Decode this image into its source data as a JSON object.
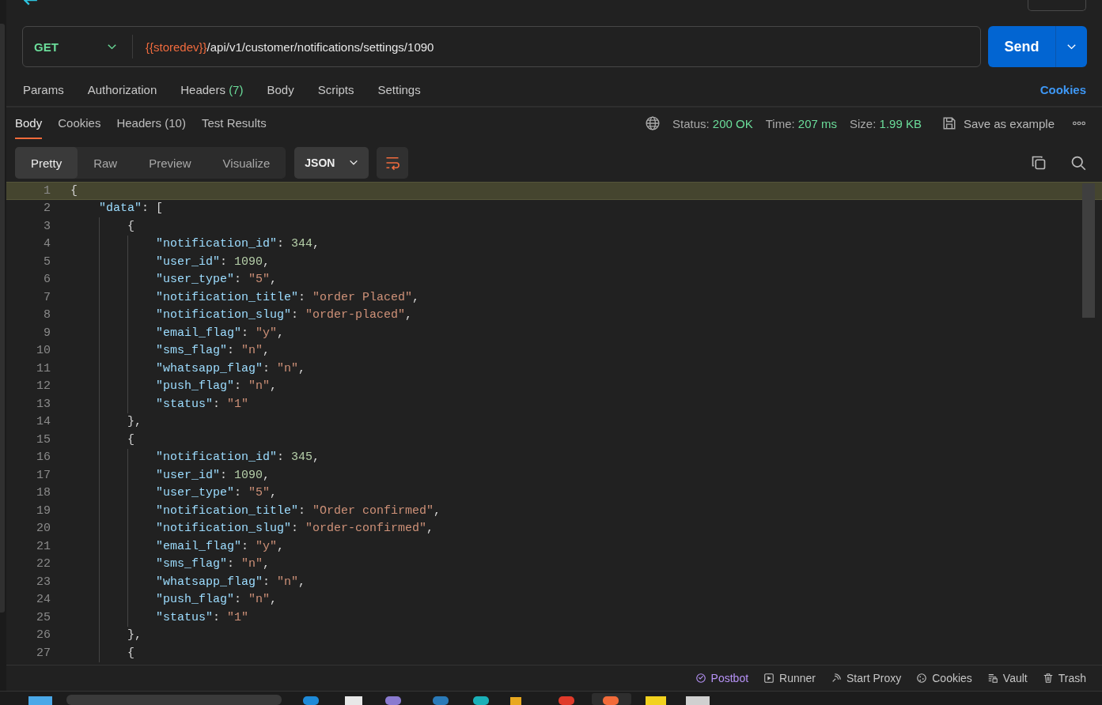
{
  "request": {
    "method": "GET",
    "url_variable": "{{storedev}}",
    "url_path": "/api/v1/customer/notifications/settings/1090",
    "send_label": "Send"
  },
  "request_tabs": [
    {
      "label": "Params"
    },
    {
      "label": "Authorization"
    },
    {
      "label": "Headers",
      "count": "(7)"
    },
    {
      "label": "Body"
    },
    {
      "label": "Scripts"
    },
    {
      "label": "Settings"
    }
  ],
  "cookies_link": "Cookies",
  "response_tabs": [
    {
      "label": "Body",
      "selected": true
    },
    {
      "label": "Cookies",
      "selected": false
    },
    {
      "label": "Headers",
      "count": "(10)",
      "selected": false
    },
    {
      "label": "Test Results",
      "selected": false
    }
  ],
  "response_meta": [
    {
      "label": "Status:",
      "value": "200 OK"
    },
    {
      "label": "Time:",
      "value": "207 ms"
    },
    {
      "label": "Size:",
      "value": "1.99 KB"
    }
  ],
  "save_example": "Save as example",
  "view_modes": [
    {
      "label": "Pretty",
      "selected": true
    },
    {
      "label": "Raw",
      "selected": false
    },
    {
      "label": "Preview",
      "selected": false
    },
    {
      "label": "Visualize",
      "selected": false
    }
  ],
  "format": "JSON",
  "code_lines": [
    {
      "number": "1",
      "text": "{",
      "current": true
    },
    {
      "number": "2",
      "text": "    \"data\": [",
      "current": false
    },
    {
      "number": "3",
      "text": "        {",
      "current": false
    },
    {
      "number": "4",
      "text": "            \"notification_id\": 344,",
      "current": false
    },
    {
      "number": "5",
      "text": "            \"user_id\": 1090,",
      "current": false
    },
    {
      "number": "6",
      "text": "            \"user_type\": \"5\",",
      "current": false
    },
    {
      "number": "7",
      "text": "            \"notification_title\": \"order Placed\",",
      "current": false
    },
    {
      "number": "8",
      "text": "            \"notification_slug\": \"order-placed\",",
      "current": false
    },
    {
      "number": "9",
      "text": "            \"email_flag\": \"y\",",
      "current": false
    },
    {
      "number": "10",
      "text": "            \"sms_flag\": \"n\",",
      "current": false
    },
    {
      "number": "11",
      "text": "            \"whatsapp_flag\": \"n\",",
      "current": false
    },
    {
      "number": "12",
      "text": "            \"push_flag\": \"n\",",
      "current": false
    },
    {
      "number": "13",
      "text": "            \"status\": \"1\"",
      "current": false
    },
    {
      "number": "14",
      "text": "        },",
      "current": false
    },
    {
      "number": "15",
      "text": "        {",
      "current": false
    },
    {
      "number": "16",
      "text": "            \"notification_id\": 345,",
      "current": false
    },
    {
      "number": "17",
      "text": "            \"user_id\": 1090,",
      "current": false
    },
    {
      "number": "18",
      "text": "            \"user_type\": \"5\",",
      "current": false
    },
    {
      "number": "19",
      "text": "            \"notification_title\": \"Order confirmed\",",
      "current": false
    },
    {
      "number": "20",
      "text": "            \"notification_slug\": \"order-confirmed\",",
      "current": false
    },
    {
      "number": "21",
      "text": "            \"email_flag\": \"y\",",
      "current": false
    },
    {
      "number": "22",
      "text": "            \"sms_flag\": \"n\",",
      "current": false
    },
    {
      "number": "23",
      "text": "            \"whatsapp_flag\": \"n\",",
      "current": false
    },
    {
      "number": "24",
      "text": "            \"push_flag\": \"n\",",
      "current": false
    },
    {
      "number": "25",
      "text": "            \"status\": \"1\"",
      "current": false
    },
    {
      "number": "26",
      "text": "        },",
      "current": false
    },
    {
      "number": "27",
      "text": "        {",
      "current": false
    }
  ],
  "status_bar": [
    {
      "label": "Postbot",
      "kind": "postbot",
      "color": "#b692f6"
    },
    {
      "label": "Runner",
      "kind": "runner",
      "color": "#c4c4c4"
    },
    {
      "label": "Start Proxy",
      "kind": "proxy",
      "color": "#c4c4c4"
    },
    {
      "label": "Cookies",
      "kind": "cookies",
      "color": "#c4c4c4"
    },
    {
      "label": "Vault",
      "kind": "vault",
      "color": "#c4c4c4"
    },
    {
      "label": "Trash",
      "kind": "trash",
      "color": "#c4c4c4"
    }
  ]
}
